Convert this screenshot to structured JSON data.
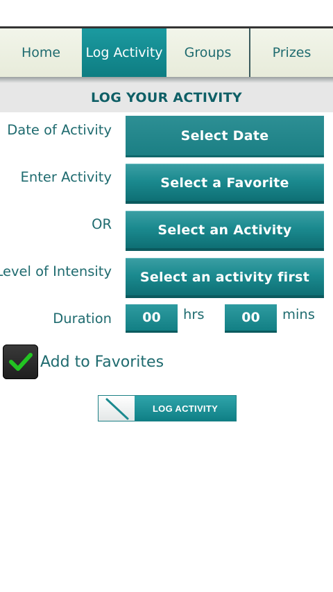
{
  "tabs": [
    {
      "label": "Home"
    },
    {
      "label": "Log Activity"
    },
    {
      "label": "Groups"
    },
    {
      "label": "Prizes"
    }
  ],
  "header": {
    "title": "LOG YOUR ACTIVITY"
  },
  "form": {
    "date": {
      "label": "Date of Activity",
      "button": "Select Date"
    },
    "activity": {
      "label": "Enter Activity",
      "button": "Select a Favorite"
    },
    "or": {
      "label": "OR",
      "button": "Select an Activity"
    },
    "intensity": {
      "label": "Level of Intensity",
      "button": "Select an activity first"
    },
    "duration": {
      "label": "Duration",
      "hours_value": "00",
      "hours_unit": "hrs",
      "minutes_value": "00",
      "minutes_unit": "mins"
    }
  },
  "favorites": {
    "label": "Add to Favorites",
    "checked": true
  },
  "submit": {
    "label": "LOG ACTIVITY"
  },
  "colors": {
    "accent": "#1b8a8f",
    "text": "#1f6b6f",
    "check": "#22c422"
  }
}
